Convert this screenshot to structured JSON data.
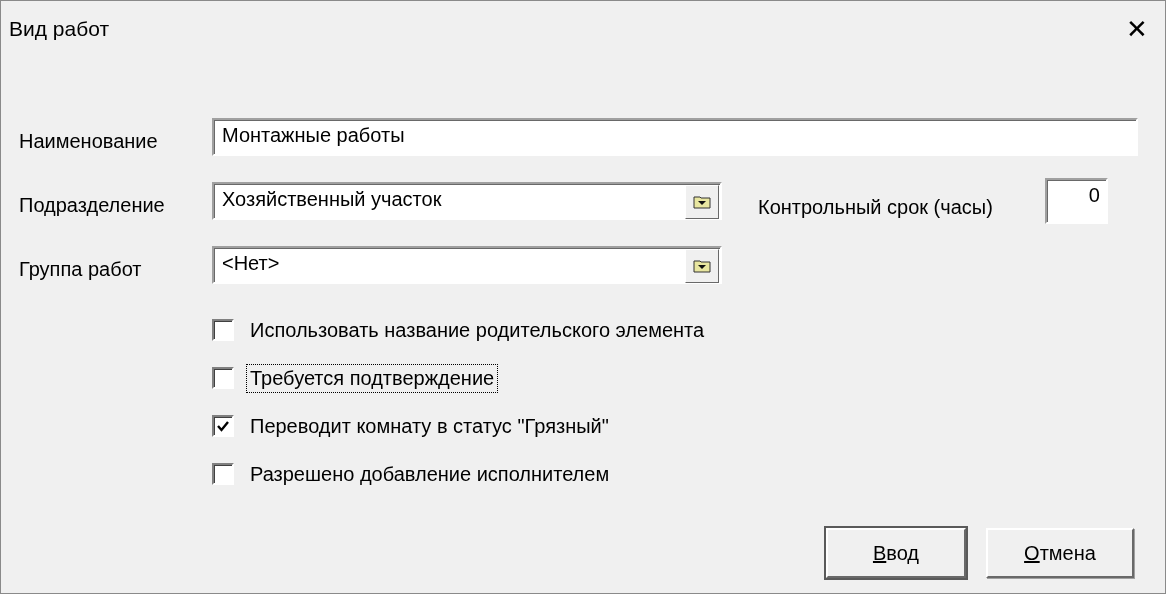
{
  "window": {
    "title": "Вид работ",
    "close": "✕"
  },
  "fields": [
    {
      "label": "Наименование",
      "value": "Монтажные работы",
      "kind": "text"
    },
    {
      "label": "Подразделение",
      "value": "Хозяйственный участок",
      "kind": "picker"
    },
    {
      "label": "Группа работ",
      "value": "<Нет>",
      "kind": "picker"
    }
  ],
  "deadline": {
    "label": "Контрольный срок (часы)",
    "value": "0"
  },
  "checkboxes": [
    {
      "label": "Использовать название родительского элемента",
      "checked": false,
      "focused": false
    },
    {
      "label": "Требуется подтверждение",
      "checked": false,
      "focused": true
    },
    {
      "label": "Переводит комнату в статус \"Грязный\"",
      "checked": true,
      "focused": false
    },
    {
      "label": "Разрешено добавление исполнителем",
      "checked": false,
      "focused": false
    }
  ],
  "buttons": [
    {
      "label": "Ввод",
      "default": true
    },
    {
      "label": "Отмена",
      "default": false
    }
  ]
}
